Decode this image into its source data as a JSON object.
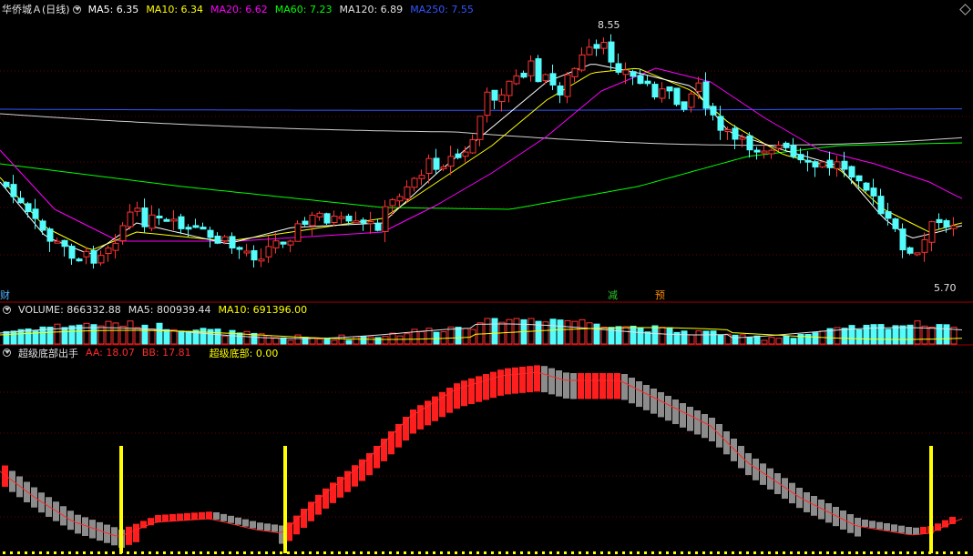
{
  "price_panel": {
    "title": "华侨城Ａ(日线)",
    "ma_indicators": [
      {
        "label": "MA5: 6.35",
        "color": "#ffffff"
      },
      {
        "label": "MA10: 6.34",
        "color": "#ffff00"
      },
      {
        "label": "MA20: 6.62",
        "color": "#ff00ff"
      },
      {
        "label": "MA60: 7.23",
        "color": "#00ff00"
      },
      {
        "label": "MA120: 6.89",
        "color": "#e0e0e0"
      },
      {
        "label": "MA250: 7.55",
        "color": "#3355ff"
      }
    ],
    "high_label": "8.55",
    "low_label": "5.70",
    "markers": [
      {
        "text": "财",
        "color": "#4fb3ff"
      },
      {
        "text": "减",
        "color": "#28c828"
      },
      {
        "text": "预",
        "color": "#ff8c00"
      }
    ]
  },
  "volume_panel": {
    "indicators": [
      {
        "label": "VOLUME: 866332.88",
        "color": "#e0e0e0"
      },
      {
        "label": "MA5: 800939.44",
        "color": "#e0e0e0"
      },
      {
        "label": "MA10: 691396.00",
        "color": "#ffff00"
      }
    ]
  },
  "indicator_panel": {
    "name": "超级底部出手",
    "indicators": [
      {
        "label": "AA: 18.07",
        "color": "#ff2a2a"
      },
      {
        "label": "BB: 17.81",
        "color": "#ff2a2a"
      },
      {
        "label": "超级底部: 0.00",
        "color": "#ffff00"
      }
    ]
  },
  "colors": {
    "up": "#ff3232",
    "down": "#54fcfc",
    "background": "#000000",
    "grid": "#800000"
  }
}
